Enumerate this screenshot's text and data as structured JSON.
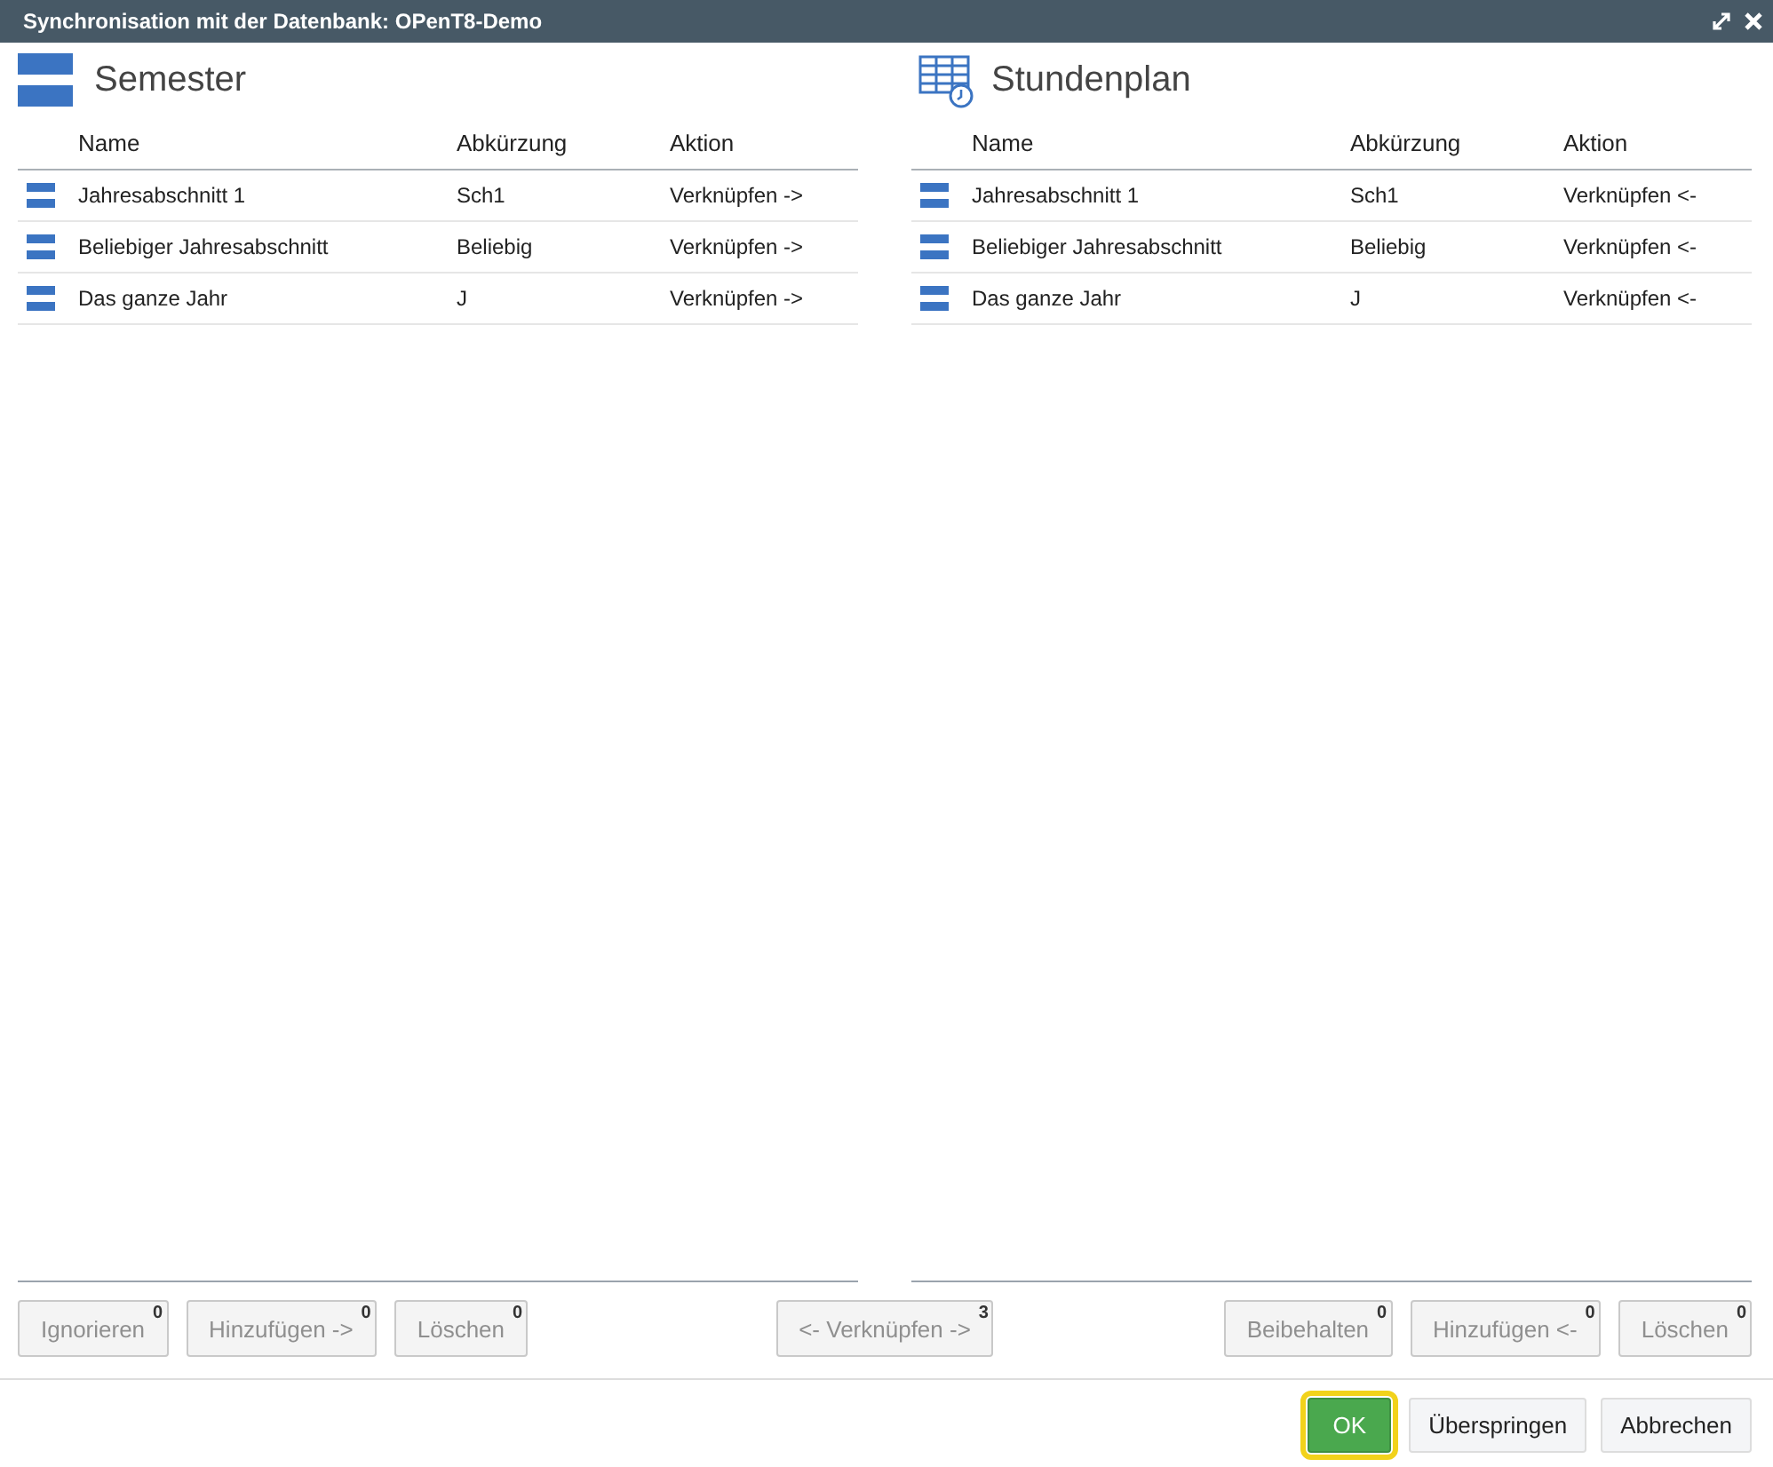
{
  "window": {
    "title": "Synchronisation mit der Datenbank: OPenT8-Demo"
  },
  "panels": [
    {
      "kind": "semester",
      "title": "Semester",
      "columns": [
        "Name",
        "Abkürzung",
        "Aktion"
      ],
      "rows": [
        {
          "name": "Jahresabschnitt 1",
          "abbreviation": "Sch1",
          "action": "Verknüpfen ->"
        },
        {
          "name": "Beliebiger Jahresabschnitt",
          "abbreviation": "Beliebig",
          "action": "Verknüpfen ->"
        },
        {
          "name": "Das ganze Jahr",
          "abbreviation": "J",
          "action": "Verknüpfen ->"
        }
      ]
    },
    {
      "kind": "timetable",
      "title": "Stundenplan",
      "columns": [
        "Name",
        "Abkürzung",
        "Aktion"
      ],
      "rows": [
        {
          "name": "Jahresabschnitt 1",
          "abbreviation": "Sch1",
          "action": "Verknüpfen <-"
        },
        {
          "name": "Beliebiger Jahresabschnitt",
          "abbreviation": "Beliebig",
          "action": "Verknüpfen <-"
        },
        {
          "name": "Das ganze Jahr",
          "abbreviation": "J",
          "action": "Verknüpfen <-"
        }
      ]
    }
  ],
  "actions": {
    "left": [
      {
        "label": "Ignorieren",
        "count": "0",
        "disabled": true
      },
      {
        "label": "Hinzufügen ->",
        "count": "0",
        "disabled": true
      },
      {
        "label": "Löschen",
        "count": "0",
        "disabled": true
      }
    ],
    "center": [
      {
        "label": "<- Verknüpfen ->",
        "count": "3",
        "disabled": true
      }
    ],
    "right": [
      {
        "label": "Beibehalten",
        "count": "0",
        "disabled": true
      },
      {
        "label": "Hinzufügen <-",
        "count": "0",
        "disabled": true
      },
      {
        "label": "Löschen",
        "count": "0",
        "disabled": true
      }
    ]
  },
  "footer": [
    {
      "label": "OK",
      "kind": "primary",
      "focused": true
    },
    {
      "label": "Überspringen",
      "kind": "default",
      "focused": false
    },
    {
      "label": "Abbrechen",
      "kind": "default",
      "focused": false
    }
  ]
}
